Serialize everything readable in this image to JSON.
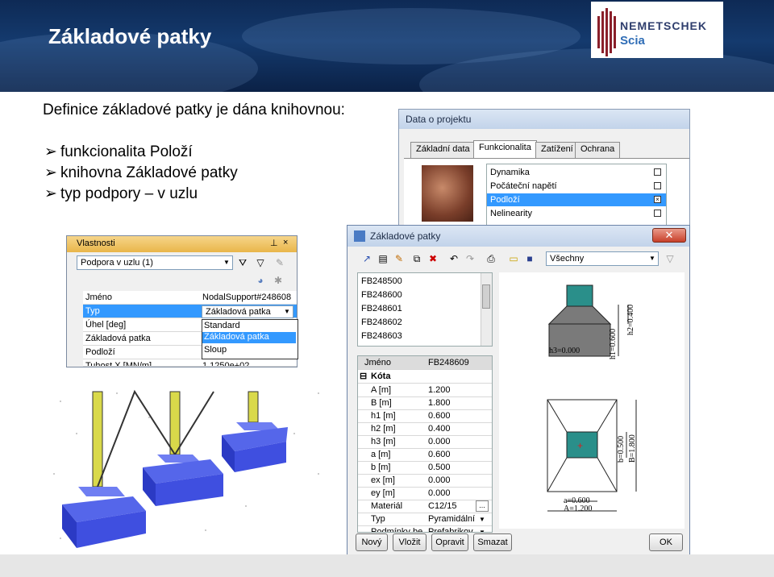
{
  "slide": {
    "title": "Základové patky",
    "intro": "Definice základové patky je dána knihovnou:",
    "bullets": [
      "funkcionalita Položí",
      "knihovna Základové patky",
      "typ podpory – v uzlu"
    ],
    "bullet_glyph": "➢"
  },
  "logo": {
    "line1": "NEMETSCHEK",
    "line2": "Scia"
  },
  "project_window": {
    "title": "Data o projektu",
    "tabs": [
      "Základní data",
      "Funkcionalita",
      "Zatížení",
      "Ochrana"
    ],
    "active_tab": "Funkcionalita",
    "items": [
      {
        "label": "Dynamika",
        "checked": false
      },
      {
        "label": "Počáteční napětí",
        "checked": false
      },
      {
        "label": "Podloží",
        "checked": true
      },
      {
        "label": "Nelinearity",
        "checked": false
      }
    ]
  },
  "properties_panel": {
    "title": "Vlastnosti",
    "selector": "Podpora v uzlu (1)",
    "rows": [
      {
        "key": "Jméno",
        "value": "NodalSupport#248608"
      },
      {
        "key": "Typ",
        "value": "Základová patka"
      },
      {
        "key": "Úhel [deg]",
        "value": ""
      },
      {
        "key": "Základová patka",
        "value": ""
      },
      {
        "key": "Podloží",
        "value": ""
      },
      {
        "key": "Tuhost X [MN/m]",
        "value": "1.1250e+02"
      }
    ],
    "type_options": [
      "Standard",
      "Základová patka",
      "Sloup"
    ],
    "type_selected": "Základová patka"
  },
  "footing_dialog": {
    "title": "Základové patky",
    "filter": "Všechny",
    "list": [
      "FB248500",
      "FB248600",
      "FB248601",
      "FB248602",
      "FB248603"
    ],
    "name_label": "Jméno",
    "name_value": "FB248609",
    "group": "Kóta",
    "params": [
      {
        "key": "A [m]",
        "value": "1.200"
      },
      {
        "key": "B [m]",
        "value": "1.800"
      },
      {
        "key": "h1 [m]",
        "value": "0.600"
      },
      {
        "key": "h2 [m]",
        "value": "0.400"
      },
      {
        "key": "h3 [m]",
        "value": "0.000"
      },
      {
        "key": "a [m]",
        "value": "0.600"
      },
      {
        "key": "b [m]",
        "value": "0.500"
      },
      {
        "key": "ex [m]",
        "value": "0.000"
      },
      {
        "key": "ey [m]",
        "value": "0.000"
      },
      {
        "key": "Materiál",
        "value": "C12/15"
      },
      {
        "key": "Typ",
        "value": "Pyramidální"
      },
      {
        "key": "Podmínky be...",
        "value": "Prefabrikov"
      }
    ],
    "buttons": [
      "Nový",
      "Vložit",
      "Opravit",
      "Smazat",
      "OK"
    ],
    "drawing_labels": {
      "h3": "h3=0.000",
      "h1": "h1=0.600",
      "h2": "h2=0.400",
      "b": "b=0.500",
      "B": "B=1.800",
      "a": "a=0.600",
      "A": "A=1.200"
    }
  },
  "colors": {
    "banner": "#143a6e",
    "footing_blue": "#3f4fe0",
    "column_yellow": "#d9d94a",
    "selection": "#3399ff",
    "teal": "#2a8f8a"
  }
}
